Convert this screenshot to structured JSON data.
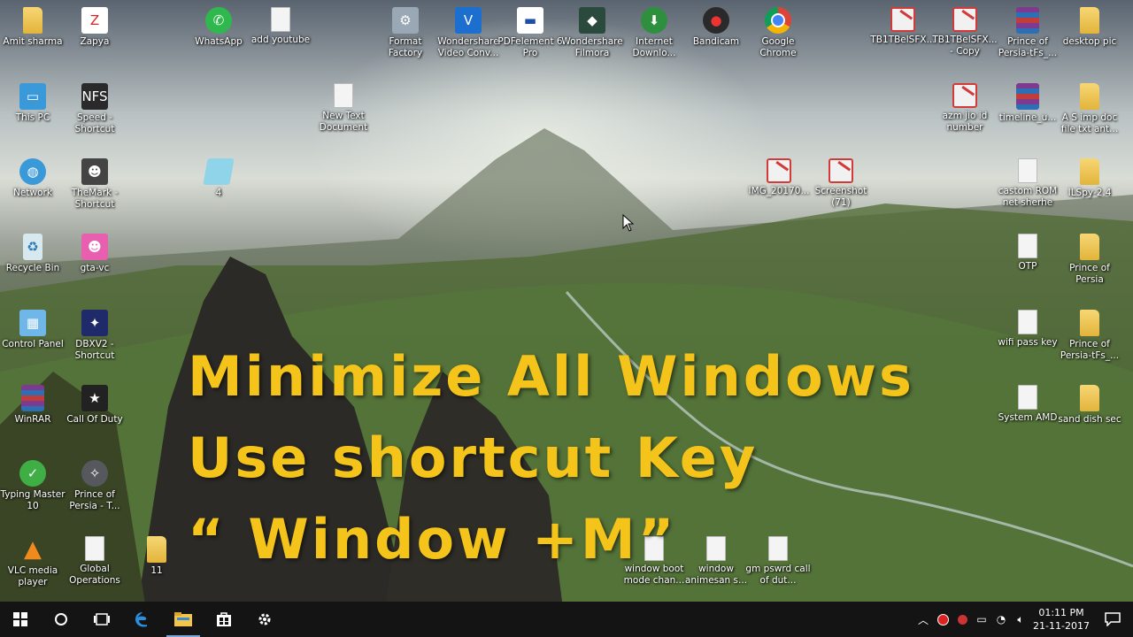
{
  "desktop": {
    "icons": [
      {
        "label": "Amit sharma",
        "icon": "user-folder-icon"
      },
      {
        "label": "Zapya",
        "icon": "zapya-icon"
      },
      {
        "label": "WhatsApp",
        "icon": "whatsapp-icon"
      },
      {
        "label": "add youtube",
        "icon": "document-icon"
      },
      {
        "label": "Format Factory",
        "icon": "format-factory-icon"
      },
      {
        "label": "Wondershare Video Conv...",
        "icon": "wondershare-video-icon"
      },
      {
        "label": "PDFelement 6 Pro",
        "icon": "pdfelement-icon"
      },
      {
        "label": "Wondershare Filmora",
        "icon": "filmora-icon"
      },
      {
        "label": "Internet Downlo...",
        "icon": "idm-icon"
      },
      {
        "label": "Bandicam",
        "icon": "bandicam-icon"
      },
      {
        "label": "Google Chrome",
        "icon": "chrome-icon"
      },
      {
        "label": "TB1TBelSFX...",
        "icon": "image-file-icon"
      },
      {
        "label": "TB1TBelSFX... - Copy",
        "icon": "image-file-icon"
      },
      {
        "label": "Prince of Persia-tFs_...",
        "icon": "winrar-archive-icon"
      },
      {
        "label": "desktop pic",
        "icon": "folder-icon"
      },
      {
        "label": "This PC",
        "icon": "computer-icon"
      },
      {
        "label": "Speed - Shortcut",
        "icon": "game-shortcut-icon"
      },
      {
        "label": "New Text Document",
        "icon": "document-icon"
      },
      {
        "label": "azm jio id number",
        "icon": "image-file-icon"
      },
      {
        "label": "timeline_u...",
        "icon": "winrar-archive-icon"
      },
      {
        "label": "A S imp doc file txt ant...",
        "icon": "folder-icon"
      },
      {
        "label": "Network",
        "icon": "network-icon"
      },
      {
        "label": "TheMark - Shortcut",
        "icon": "game-shortcut-icon"
      },
      {
        "label": "4",
        "icon": "file-icon"
      },
      {
        "label": "IMG_20170...",
        "icon": "image-file-icon"
      },
      {
        "label": "Screenshot (71)",
        "icon": "image-file-icon"
      },
      {
        "label": "castom ROM net sherhe",
        "icon": "document-icon"
      },
      {
        "label": "ILSpy-2.4",
        "icon": "folder-icon"
      },
      {
        "label": "Recycle Bin",
        "icon": "recycle-bin-icon"
      },
      {
        "label": "gta-vc",
        "icon": "game-shortcut-icon"
      },
      {
        "label": "OTP",
        "icon": "document-icon"
      },
      {
        "label": "Prince of Persia",
        "icon": "folder-icon"
      },
      {
        "label": "Control Panel",
        "icon": "control-panel-icon"
      },
      {
        "label": "DBXV2 - Shortcut",
        "icon": "game-shortcut-icon"
      },
      {
        "label": "wifi pass key",
        "icon": "document-icon"
      },
      {
        "label": "Prince of Persia-tFs_...",
        "icon": "folder-icon"
      },
      {
        "label": "WinRAR",
        "icon": "winrar-icon"
      },
      {
        "label": "Call Of Duty",
        "icon": "game-shortcut-icon"
      },
      {
        "label": "System AMD",
        "icon": "document-icon"
      },
      {
        "label": "sand dish sec",
        "icon": "folder-icon"
      },
      {
        "label": "Typing Master 10",
        "icon": "typing-master-icon"
      },
      {
        "label": "Prince of Persia - T...",
        "icon": "game-shortcut-icon"
      },
      {
        "label": "VLC media player",
        "icon": "vlc-icon"
      },
      {
        "label": "Global Operations",
        "icon": "document-icon"
      },
      {
        "label": "11",
        "icon": "folder-icon"
      },
      {
        "label": "window boot mode chan...",
        "icon": "document-icon"
      },
      {
        "label": "window animesan s...",
        "icon": "document-icon"
      },
      {
        "label": "gm pswrd call of dut...",
        "icon": "document-icon"
      }
    ]
  },
  "headline": {
    "line1": "Minimize All Windows",
    "line2": "Use shortcut Key",
    "line3": "“ Window +M”"
  },
  "taskbar": {
    "clock_time": "01:11 PM",
    "clock_date": "21-11-2017"
  },
  "colors": {
    "headline": "#f5c41a",
    "taskbar": "#141414",
    "accent": "#79a8d8"
  }
}
